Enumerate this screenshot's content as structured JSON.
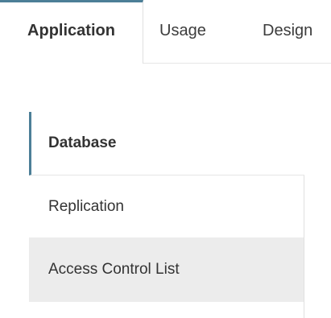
{
  "tabs": {
    "items": [
      {
        "label": "Application",
        "active": true
      },
      {
        "label": "Usage",
        "active": false
      },
      {
        "label": "Design",
        "active": false
      }
    ]
  },
  "sidenav": {
    "items": [
      {
        "label": "Database",
        "active": true
      },
      {
        "label": "Replication",
        "active": false
      },
      {
        "label": "Access Control List",
        "active": false,
        "hovered": true
      }
    ]
  },
  "colors": {
    "accent": "#4c7f97",
    "hover_background": "#ececec",
    "border": "#e0e0e0"
  }
}
